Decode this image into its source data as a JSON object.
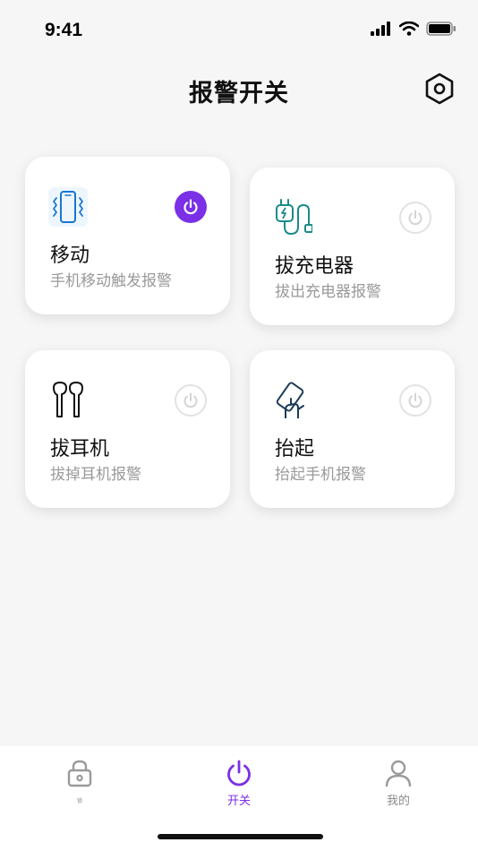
{
  "status": {
    "time": "9:41"
  },
  "header": {
    "title": "报警开关"
  },
  "cards": [
    {
      "title": "移动",
      "subtitle": "手机移动触发报警",
      "enabled": true
    },
    {
      "title": "拔充电器",
      "subtitle": "拔出充电器报警",
      "enabled": false
    },
    {
      "title": "拔耳机",
      "subtitle": "拔掉耳机报警",
      "enabled": false
    },
    {
      "title": "抬起",
      "subtitle": "抬起手机报警",
      "enabled": false
    }
  ],
  "tabs": [
    {
      "label": "锁",
      "icon": "lock-icon",
      "active": false
    },
    {
      "label": "开关",
      "icon": "power-icon",
      "active": true
    },
    {
      "label": "我的",
      "icon": "person-icon",
      "active": false
    }
  ],
  "colors": {
    "accent": "#7b2fe6",
    "card_bg": "#ffffff",
    "page_bg": "#f6f6f6"
  }
}
